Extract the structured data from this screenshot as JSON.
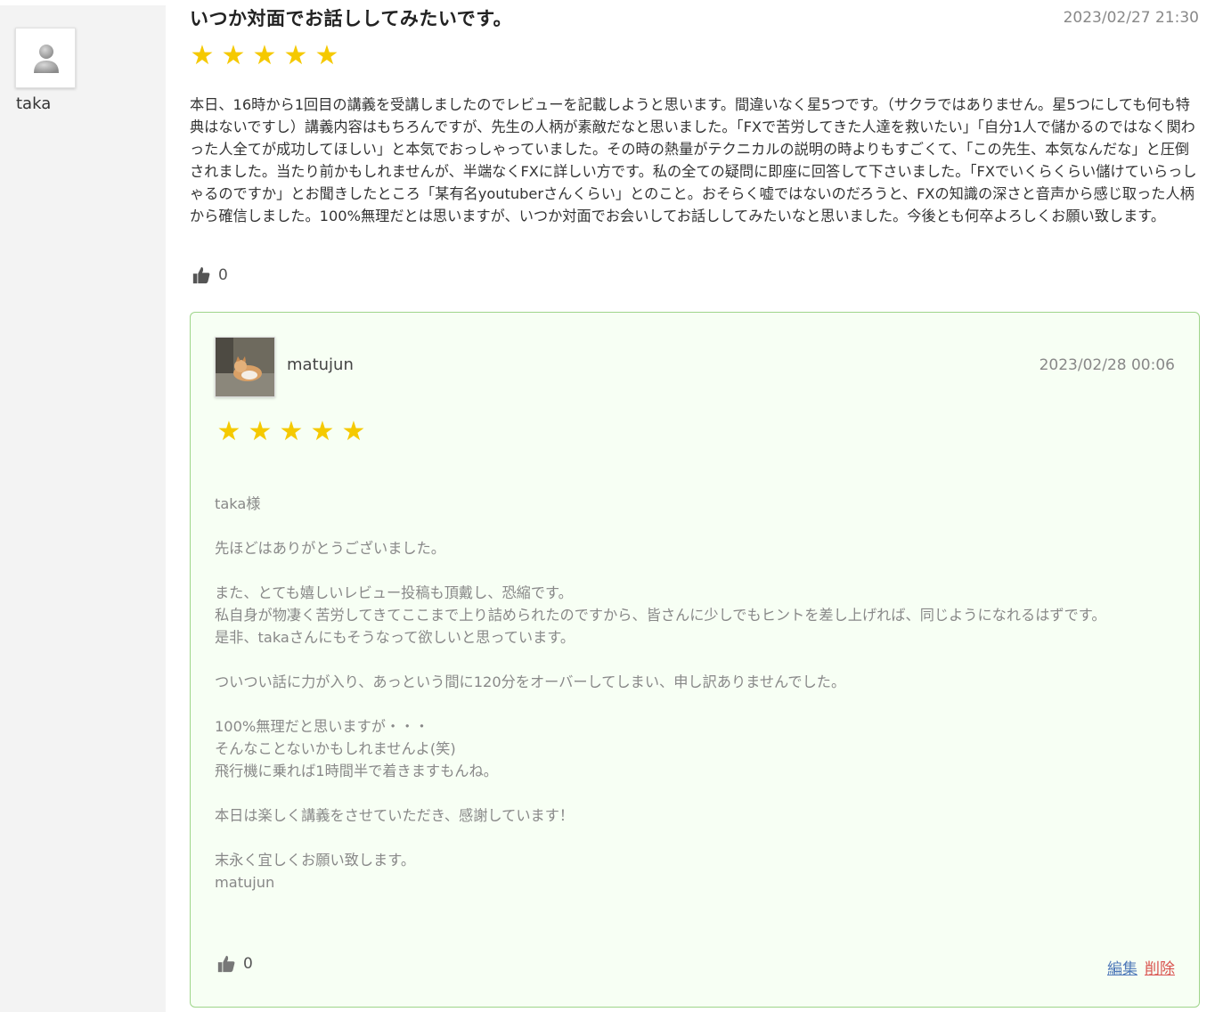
{
  "reviewer": {
    "name": "taka"
  },
  "review": {
    "title": "いつか対面でお話ししてみたいです。",
    "date": "2023/02/27 21:30",
    "rating": 5,
    "body": "本日、16時から1回目の講義を受講しましたのでレビューを記載しようと思います。間違いなく星5つです。（サクラではありません。星5つにしても何も特典はないですし）講義内容はもちろんですが、先生の人柄が素敵だなと思いました。「FXで苦労してきた人達を救いたい」「自分1人で儲かるのではなく関わった人全てが成功してほしい」と本気でおっしゃっていました。その時の熱量がテクニカルの説明の時よりもすごくて、「この先生、本気なんだな」と圧倒されました。当たり前かもしれませんが、半端なくFXに詳しい方です。私の全ての疑問に即座に回答して下さいました。「FXでいくらくらい儲けていらっしゃるのですか」とお聞きしたところ「某有名youtuberさんくらい」とのこと。おそらく嘘ではないのだろうと、FXの知識の深さと音声から感じ取った人柄から確信しました。100%無理だとは思いますが、いつか対面でお会いしてお話ししてみたいなと思いました。今後とも何卒よろしくお願い致します。",
    "like_count": "0"
  },
  "reply": {
    "name": "matujun",
    "date": "2023/02/28 00:06",
    "rating": 5,
    "body": "taka様\n\n先ほどはありがとうございました。\n\nまた、とても嬉しいレビュー投稿も頂戴し、恐縮です。\n私自身が物凄く苦労してきてここまで上り詰められたのですから、皆さんに少しでもヒントを差し上げれば、同じようになれるはずです。\n是非、takaさんにもそうなって欲しいと思っています。\n\nついつい話に力が入り、あっという間に120分をオーバーしてしまい、申し訳ありませんでした。\n\n100%無理だと思いますが・・・\nそんなことないかもしれませんよ(笑)\n飛行機に乗れば1時間半で着きますもんね。\n\n本日は楽しく講義をさせていただき、感謝しています！\n\n末永く宜しくお願い致します。\nmatujun",
    "like_count": "0",
    "edit_label": "編集",
    "delete_label": "削除"
  },
  "star_glyph": "★",
  "colors": {
    "star": "#f5c900",
    "reply_border": "#9ed58a",
    "reply_bg": "#f7fff4",
    "edit_link": "#4f79b9",
    "delete_link": "#d9534f"
  }
}
